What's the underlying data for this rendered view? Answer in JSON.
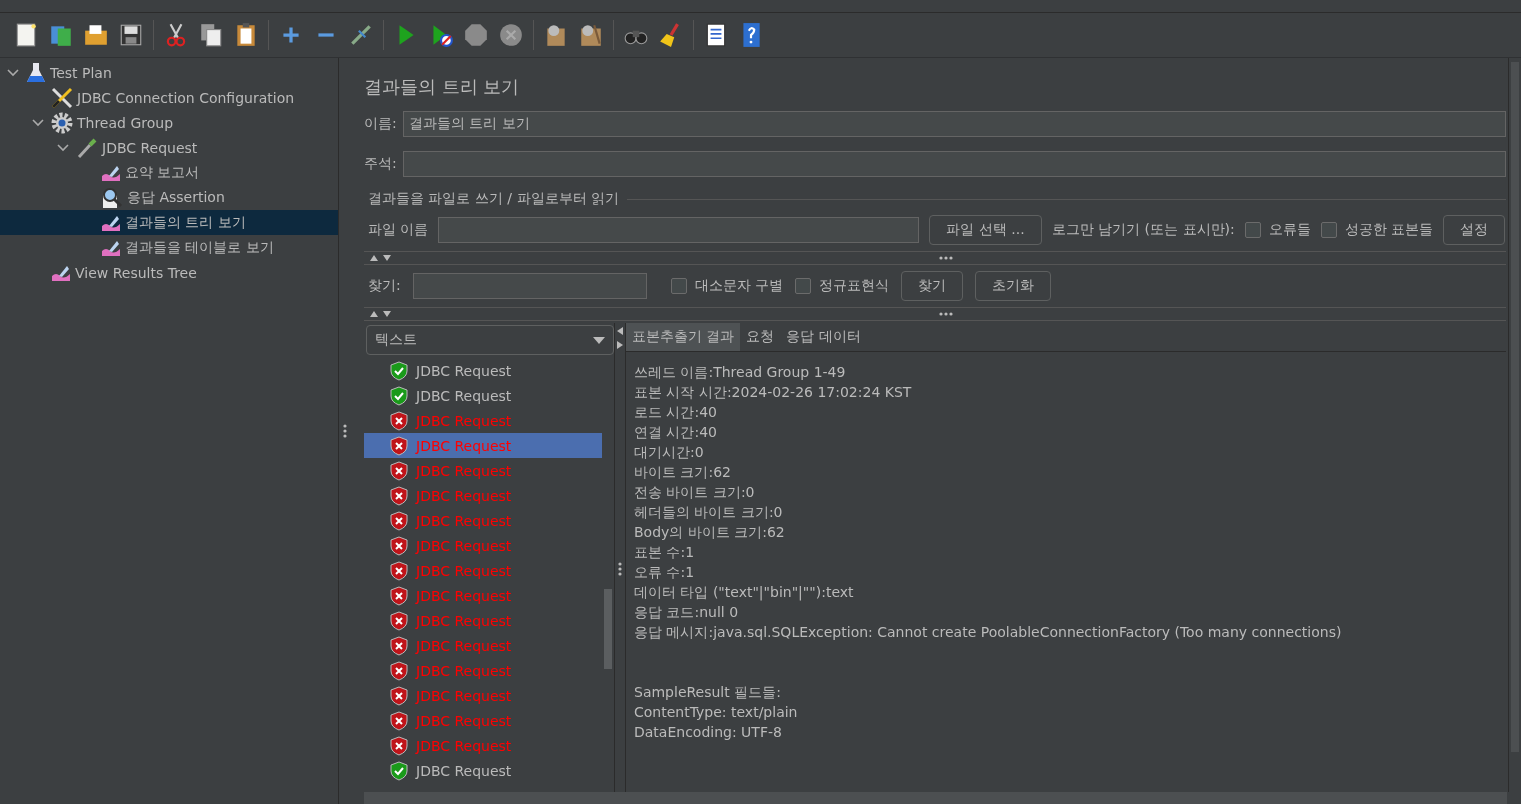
{
  "tree": [
    {
      "label": "Test Plan",
      "kind": "flask",
      "expanded": true,
      "selected": false,
      "children": [
        {
          "label": "JDBC Connection Configuration",
          "kind": "tools",
          "selected": false
        },
        {
          "label": "Thread Group",
          "kind": "gear",
          "expanded": true,
          "selected": false,
          "children": [
            {
              "label": "JDBC Request",
              "kind": "dropper",
              "expanded": true,
              "selected": false,
              "children": [
                {
                  "label": "요약 보고서",
                  "kind": "chart",
                  "selected": false
                },
                {
                  "label": "응답 Assertion",
                  "kind": "magnifier",
                  "selected": false
                },
                {
                  "label": "결과들의 트리 보기",
                  "kind": "chart",
                  "selected": true
                },
                {
                  "label": "결과들을 테이블로 보기",
                  "kind": "chart",
                  "selected": false
                }
              ]
            }
          ]
        },
        {
          "label": "View Results Tree",
          "kind": "chart",
          "selected": false
        }
      ]
    }
  ],
  "panel": {
    "title": "결과들의 트리 보기",
    "name_label": "이름:",
    "name_value": "결과들의 트리 보기",
    "comment_label": "주석:",
    "file_section": {
      "legend": "결과들을 파일로 쓰기 / 파일로부터 읽기",
      "file_label": "파일 이름",
      "browse_button": "파일 선택 ...",
      "log_label": "로그만 남기기 (또는 표시만):",
      "checkboxes": [
        {
          "label": "오류들",
          "checked": false
        },
        {
          "label": "성공한 표본들",
          "checked": false
        }
      ],
      "settings_button": "설정"
    },
    "search": {
      "label": "찾기:",
      "checkboxes": [
        {
          "label": "대소문자 구별",
          "checked": false
        },
        {
          "label": "정규표현식",
          "checked": false
        }
      ],
      "find_button": "찾기",
      "reset_button": "초기화"
    },
    "renderer": "텍스트",
    "results": [
      {
        "label": "JDBC Request",
        "failed": false,
        "selected": false
      },
      {
        "label": "JDBC Request",
        "failed": false,
        "selected": false
      },
      {
        "label": "JDBC Request",
        "failed": true,
        "selected": false
      },
      {
        "label": "JDBC Request",
        "failed": true,
        "selected": true
      },
      {
        "label": "JDBC Request",
        "failed": true,
        "selected": false
      },
      {
        "label": "JDBC Request",
        "failed": true,
        "selected": false
      },
      {
        "label": "JDBC Request",
        "failed": true,
        "selected": false
      },
      {
        "label": "JDBC Request",
        "failed": true,
        "selected": false
      },
      {
        "label": "JDBC Request",
        "failed": true,
        "selected": false
      },
      {
        "label": "JDBC Request",
        "failed": true,
        "selected": false
      },
      {
        "label": "JDBC Request",
        "failed": true,
        "selected": false
      },
      {
        "label": "JDBC Request",
        "failed": true,
        "selected": false
      },
      {
        "label": "JDBC Request",
        "failed": true,
        "selected": false
      },
      {
        "label": "JDBC Request",
        "failed": true,
        "selected": false
      },
      {
        "label": "JDBC Request",
        "failed": true,
        "selected": false
      },
      {
        "label": "JDBC Request",
        "failed": true,
        "selected": false
      },
      {
        "label": "JDBC Request",
        "failed": false,
        "selected": false
      }
    ],
    "tabs": [
      {
        "label": "표본추출기 결과",
        "selected": true
      },
      {
        "label": "요청",
        "selected": false
      },
      {
        "label": "응답 데이터",
        "selected": false
      }
    ],
    "result_sections": [
      [
        "쓰레드 이름:Thread Group 1-49",
        "표본 시작 시간:2024-02-26 17:02:24 KST",
        "로드 시간:40",
        "연결 시간:40",
        "대기시간:0",
        "바이트 크기:62",
        "전송 바이트 크기:0",
        "헤더들의 바이트 크기:0",
        "Body의 바이트 크기:62",
        "표본 수:1",
        "오류 수:1",
        "데이터 타입 (\"text\"|\"bin\"|\"\"):text",
        "응답 코드:null 0",
        "응답 메시지:java.sql.SQLException: Cannot create PoolableConnectionFactory (Too many connections)"
      ],
      [
        "SampleResult 필드들:",
        "ContentType: text/plain",
        "DataEncoding: UTF-8"
      ]
    ]
  }
}
